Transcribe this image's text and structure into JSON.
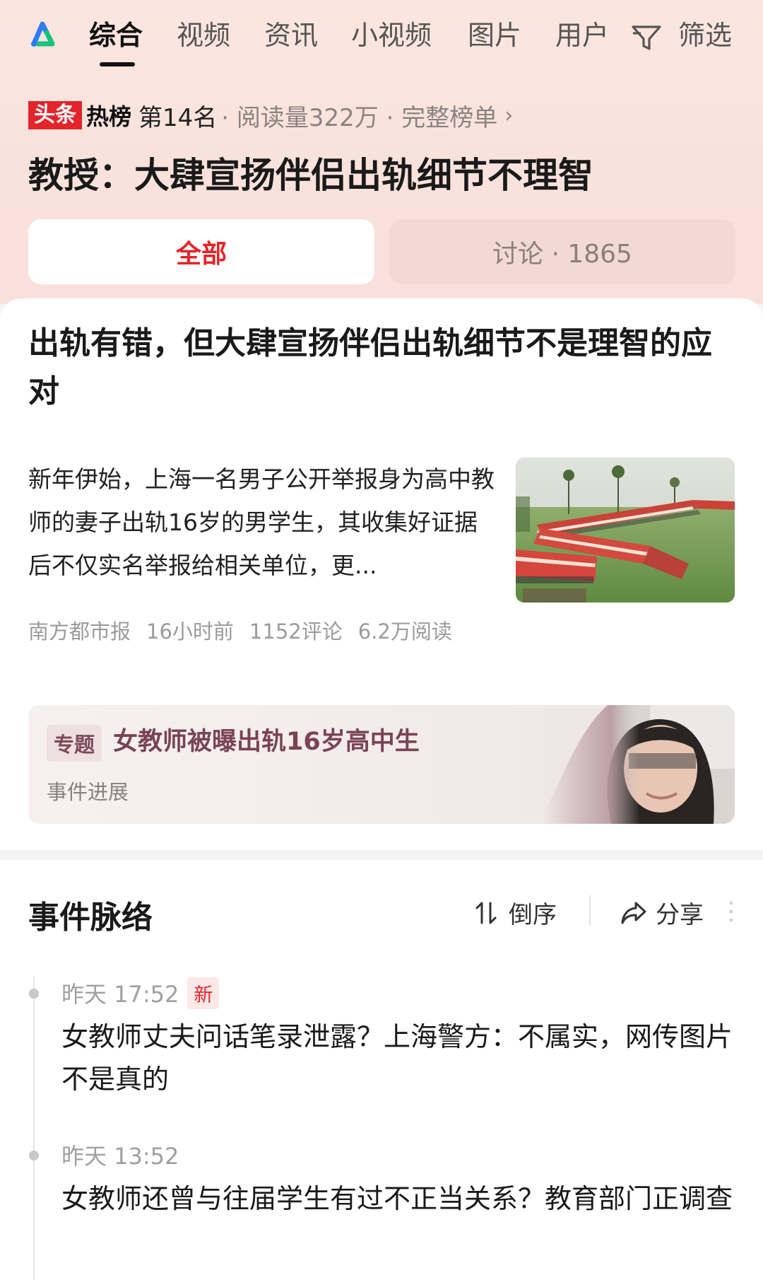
{
  "topnav": {
    "tabs": [
      {
        "label": "综合",
        "active": true
      },
      {
        "label": "视频"
      },
      {
        "label": "资讯"
      },
      {
        "label": "小视频"
      },
      {
        "label": "图片"
      },
      {
        "label": "用户"
      }
    ],
    "filter_label": "筛选"
  },
  "hot": {
    "logo_box": "头条",
    "logo_word": "热榜",
    "rank": "第14名",
    "meta": "· 阅读量322万 · 完整榜单",
    "chevron": "›"
  },
  "headline": "教授：大肆宣扬伴侣出轨细节不理智",
  "segments": {
    "all": "全部",
    "discussion": "讨论 · 1865"
  },
  "article": {
    "title": "出轨有错，但大肆宣扬伴侣出轨细节不是理智的应对",
    "summary": "新年伊始，上海一名男子公开举报身为高中教师的妻子出轨16岁的男学生，其收集好证据后不仅实名举报给相关单位，更...",
    "source": "南方都市报",
    "time": "16小时前",
    "comments": "1152评论",
    "reads": "6.2万阅读"
  },
  "topic": {
    "tag": "专题",
    "title": "女教师被曝出轨16岁高中生",
    "subtitle": "事件进展"
  },
  "timeline": {
    "title": "事件脉络",
    "sort_label": "倒序",
    "share_label": "分享",
    "items": [
      {
        "time": "昨天 17:52",
        "badge": "新",
        "text": "女教师丈夫问话笔录泄露？上海警方：不属实，网传图片不是真的"
      },
      {
        "time": "昨天 13:52",
        "text": "女教师还曾与往届学生有过不正当关系？教育部门正调查"
      }
    ]
  },
  "colors": {
    "accent_red": "#e3242b",
    "topic_title": "#7a4356"
  },
  "icons": [
    "app-logo-icon",
    "filter-icon",
    "chevron-right-icon",
    "sort-icon",
    "share-icon",
    "more-vertical-icon"
  ]
}
